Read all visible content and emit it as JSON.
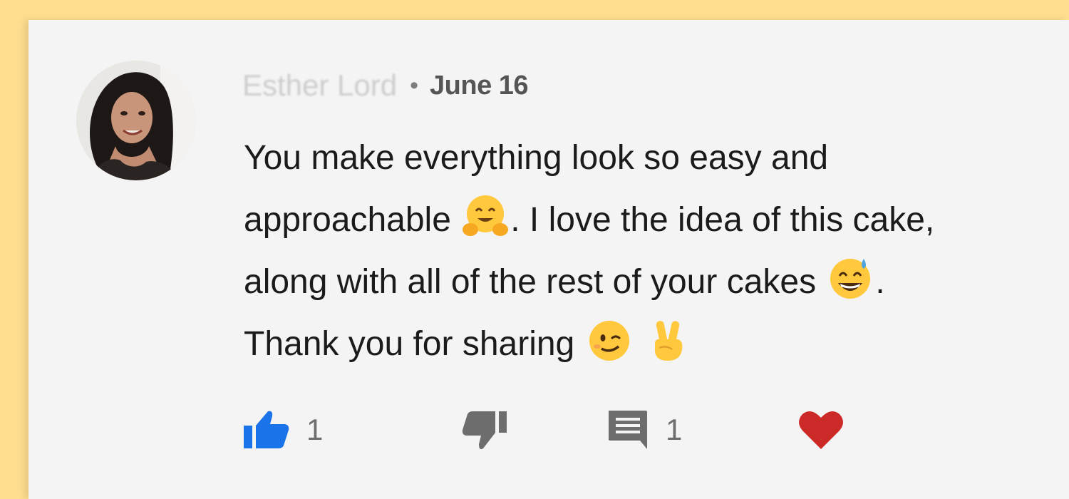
{
  "comment": {
    "author": "Esther Lord",
    "separator": "•",
    "date": "June 16",
    "lines": [
      {
        "before": "You make everything look so easy and",
        "emoji": "",
        "after": "",
        "emoji2": "",
        "after2": ""
      },
      {
        "before": "approachable ",
        "emoji": "hugging-face",
        "after": ". I love the idea of this cake,",
        "emoji2": "",
        "after2": ""
      },
      {
        "before": "along with all of the rest of your cakes ",
        "emoji": "grinning-sweat",
        "after": ".",
        "emoji2": "",
        "after2": ""
      },
      {
        "before": "Thank you for sharing ",
        "emoji": "winking-face",
        "after": " ",
        "emoji2": "victory-hand",
        "after2": ""
      }
    ]
  },
  "actions": {
    "like_count": "1",
    "reply_count": "1",
    "like_color": "#1a73e8",
    "heart_color": "#cc2929"
  },
  "icons": {
    "like": "thumbs-up-icon",
    "dislike": "thumbs-down-icon",
    "reply": "comment-icon",
    "heart": "heart-icon"
  }
}
